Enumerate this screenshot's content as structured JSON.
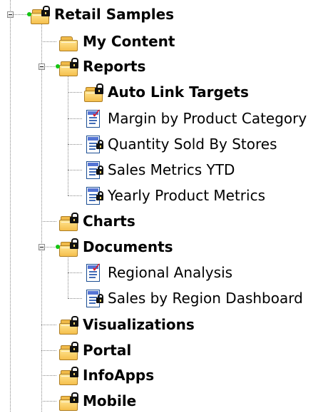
{
  "tree": {
    "root": {
      "label": "Retail Samples",
      "icon": "locked-folder-icon"
    },
    "items": [
      {
        "label": "My Content",
        "icon": "folder-icon",
        "bold": true
      },
      {
        "label": "Reports",
        "icon": "locked-folder-icon",
        "bold": true,
        "expanded": true
      },
      {
        "label": "Auto Link Targets",
        "icon": "locked-folder-icon",
        "bold": true
      },
      {
        "label": "Margin by Product Category",
        "icon": "checked-report-icon"
      },
      {
        "label": "Quantity Sold By Stores",
        "icon": "locked-report-icon"
      },
      {
        "label": "Sales Metrics YTD",
        "icon": "locked-report-icon"
      },
      {
        "label": "Yearly Product Metrics",
        "icon": "locked-report-icon"
      },
      {
        "label": "Charts",
        "icon": "locked-folder-icon",
        "bold": true
      },
      {
        "label": "Documents",
        "icon": "locked-folder-icon",
        "bold": true,
        "expanded": true
      },
      {
        "label": "Regional Analysis",
        "icon": "checked-report-icon"
      },
      {
        "label": "Sales by Region Dashboard",
        "icon": "locked-report-icon"
      },
      {
        "label": "Visualizations",
        "icon": "locked-folder-icon",
        "bold": true
      },
      {
        "label": "Portal",
        "icon": "locked-folder-icon",
        "bold": true
      },
      {
        "label": "InfoApps",
        "icon": "locked-folder-icon",
        "bold": true
      },
      {
        "label": "Mobile",
        "icon": "locked-folder-icon",
        "bold": true
      }
    ]
  }
}
